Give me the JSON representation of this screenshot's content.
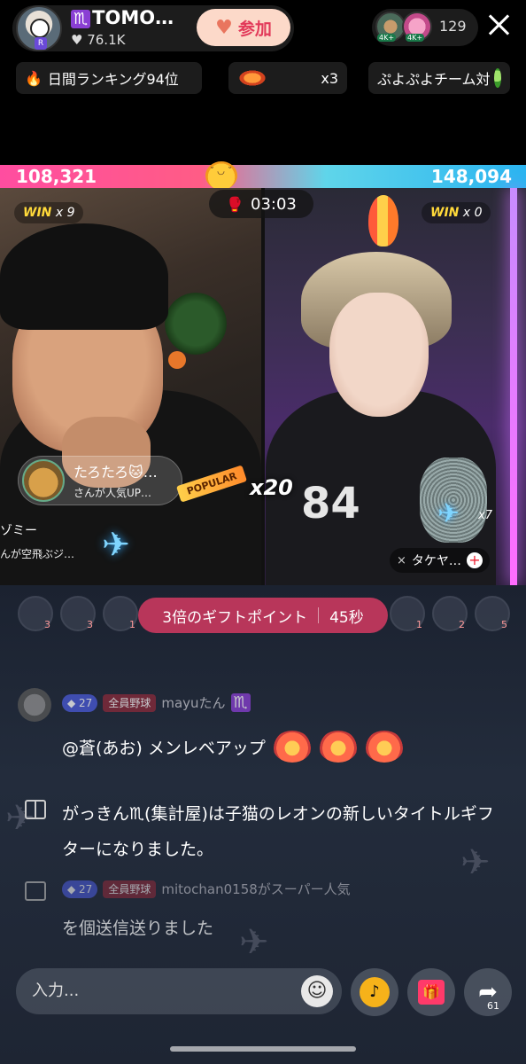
{
  "header": {
    "host_name": "TOMO…",
    "host_zodiac": "♏",
    "likes": "♥ 76.1K",
    "join_label": "参加",
    "viewer_count": "129",
    "viewer_tags": [
      "4K+",
      "4K+"
    ]
  },
  "chips": {
    "ranking": "日間ランキング94位",
    "gift_multiplier": "x3",
    "team": "ぷよぷよチーム対"
  },
  "battle": {
    "score_left": "108,321",
    "score_right": "148,094",
    "timer": "03:03",
    "win_left_label": "WIN",
    "win_left_count": "x 9",
    "win_right_label": "WIN",
    "win_right_count": "x 0",
    "popup_user_name": "たろたろ🐱…",
    "popup_user_sub": "さんが人気UP…",
    "popular_label": "POPULAR",
    "combo": "x20",
    "second_user_name": "ゾミー",
    "second_user_sub": "んが空飛ぶジ…",
    "right_gift_count": "x7",
    "right_user_name": "タケヤ…",
    "mute_icon": "×"
  },
  "gift_banner": {
    "label": "3倍のギフトポイント",
    "seconds": "45秒",
    "rank_numbers": [
      "3",
      "3",
      "1",
      "1",
      "2",
      "5"
    ]
  },
  "chat": {
    "m1_level": "27",
    "m1_team": "全員野球",
    "m1_user": "mayuたん",
    "m1_zodiac": "♏",
    "m1_text": "@蒼(あお) メンレベアップ",
    "sys_text": "がっきん♏(集計屋)は子猫のレオンの新しいタイトルギフターになりました。",
    "m2_level": "27",
    "m2_team": "全員野球",
    "m2_user": "mitochan0158がスーパー人気",
    "m2_text": "を個送信送りました"
  },
  "input": {
    "placeholder": "入力...",
    "share_count": "61"
  },
  "colors": {
    "score_left": "#ff4da0",
    "score_right": "#2bb4f0",
    "join_text": "#e23a5a",
    "banner": "#b8365a"
  }
}
